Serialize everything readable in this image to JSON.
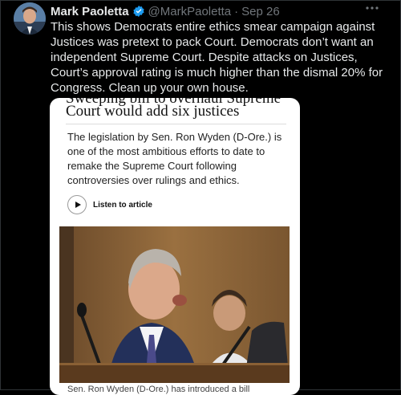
{
  "tweet": {
    "author_name": "Mark Paoletta",
    "handle": "@MarkPaoletta",
    "separator": "·",
    "date": "Sep 26",
    "more_icon": "more-horizontal-icon",
    "text": "This shows Democrats entire ethics smear campaign against Justices was pretext to pack Court. Democrats don’t want an independent Supreme Court. Despite attacks on Justices, Court’s approval rating is much higher than the dismal 20% for Congress. Clean up your own house.",
    "verified_color": "#1d9bf0"
  },
  "article_card": {
    "headline_cut": "Sweeping bill to overhaul Supreme",
    "headline": "Court would add six justices",
    "lede": "The legislation by Sen. Ron Wyden (D-Ore.) is one of the most ambitious efforts to date to remake the Supreme Court following controversies over rulings and ethics.",
    "listen_label": "Listen to article",
    "caption": "Sen. Ron Wyden (D-Ore.) has introduced a bill"
  }
}
